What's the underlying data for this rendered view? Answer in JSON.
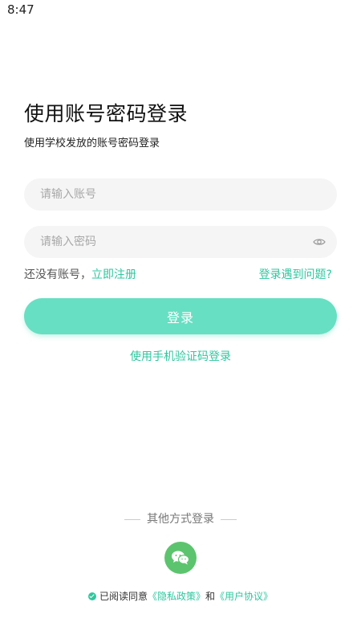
{
  "status_bar": {
    "time": "8:47"
  },
  "header": {
    "title": "使用账号密码登录",
    "subtitle": "使用学校发放的账号密码登录"
  },
  "form": {
    "account_placeholder": "请输入账号",
    "account_value": "",
    "password_placeholder": "请输入密码",
    "password_value": "",
    "no_account_text": "还没有账号，",
    "register_link": "立即注册",
    "problem_link": "登录遇到问题?",
    "login_button": "登录",
    "sms_login_link": "使用手机验证码登录"
  },
  "other_login": {
    "label": "其他方式登录",
    "icons": [
      "wechat-icon"
    ]
  },
  "agreement": {
    "text_before": "已阅读同意",
    "privacy_link": "《隐私政策》",
    "and_text": "和",
    "user_agreement_link": "《用户协议》",
    "checked": true
  },
  "colors": {
    "accent": "#2ec79e",
    "button": "#67dfc2",
    "wechat": "#5cc46e",
    "field_bg": "#f5f5f5"
  }
}
